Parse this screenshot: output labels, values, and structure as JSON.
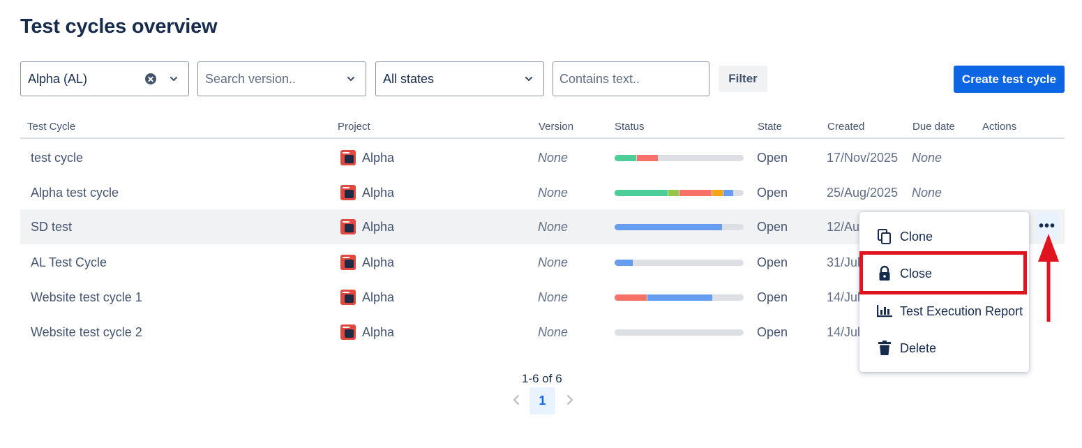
{
  "page_title": "Test cycles overview",
  "filters": {
    "project_value": "Alpha (AL)",
    "version_placeholder": "Search version..",
    "state_value": "All states",
    "text_placeholder": "Contains text..",
    "filter_label": "Filter",
    "create_label": "Create test cycle"
  },
  "table": {
    "headers": [
      "Test Cycle",
      "Project",
      "Version",
      "Status",
      "State",
      "Created",
      "Due date",
      "Actions"
    ],
    "rows": [
      {
        "name": "test cycle",
        "project": "Alpha",
        "version": "None",
        "state": "Open",
        "created": "17/Nov/2025",
        "due": "None",
        "status": [
          {
            "color": "#4bce97",
            "pct": 17
          },
          {
            "color": "#f87168",
            "pct": 16
          }
        ]
      },
      {
        "name": "Alpha test cycle",
        "project": "Alpha",
        "version": "None",
        "state": "Open",
        "created": "25/Aug/2025",
        "due": "None",
        "status": [
          {
            "color": "#4bce97",
            "pct": 41
          },
          {
            "color": "#94c748",
            "pct": 8
          },
          {
            "color": "#f87168",
            "pct": 25
          },
          {
            "color": "#f5a50f",
            "pct": 8
          },
          {
            "color": "#669df1",
            "pct": 8
          }
        ]
      },
      {
        "name": "SD test",
        "project": "Alpha",
        "version": "None",
        "state": "Open",
        "created": "12/Au",
        "due": "",
        "status": [
          {
            "color": "#669df1",
            "pct": 83
          }
        ]
      },
      {
        "name": "AL Test Cycle",
        "project": "Alpha",
        "version": "None",
        "state": "Open",
        "created": "31/Jul",
        "due": "",
        "status": [
          {
            "color": "#669df1",
            "pct": 14
          }
        ]
      },
      {
        "name": "Website test cycle 1",
        "project": "Alpha",
        "version": "None",
        "state": "Open",
        "created": "14/Jul",
        "due": "",
        "status": [
          {
            "color": "#f87168",
            "pct": 25
          },
          {
            "color": "#669df1",
            "pct": 50
          }
        ]
      },
      {
        "name": "Website test cycle 2",
        "project": "Alpha",
        "version": "None",
        "state": "Open",
        "created": "14/Jul",
        "due": "",
        "status": []
      }
    ]
  },
  "actions_menu": {
    "items": [
      {
        "label": "Clone",
        "icon": "clone-icon"
      },
      {
        "label": "Close",
        "icon": "lock-icon"
      },
      {
        "label": "Test Execution Report",
        "icon": "bar-chart-icon"
      },
      {
        "label": "Delete",
        "icon": "trash-icon"
      }
    ],
    "more_label": "•••"
  },
  "pagination": {
    "summary": "1-6 of 6",
    "current_page": "1"
  },
  "colors": {
    "accent": "#0c66e4",
    "highlight": "#e0141e"
  }
}
